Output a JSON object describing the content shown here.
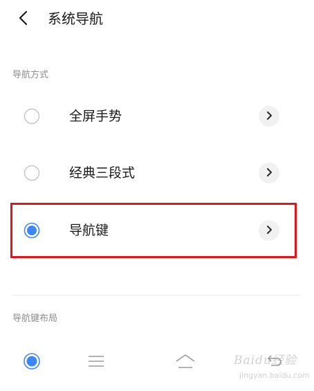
{
  "header": {
    "title": "系统导航",
    "back_icon": "chevron-left-icon"
  },
  "sections": {
    "nav_method_label": "导航方式",
    "nav_layout_label": "导航键布局"
  },
  "nav_options": [
    {
      "label": "全屏手势",
      "selected": false,
      "highlighted": false
    },
    {
      "label": "经典三段式",
      "selected": false,
      "highlighted": false
    },
    {
      "label": "导航键",
      "selected": true,
      "highlighted": true
    }
  ],
  "layout_options": [
    {
      "icon": "radio-selected-icon",
      "selected": true
    },
    {
      "icon": "menu-icon"
    },
    {
      "icon": "home-icon"
    },
    {
      "icon": "back-icon"
    }
  ],
  "watermark": {
    "title": "Baidu经验",
    "subtitle": "jingyan.baidu.com"
  },
  "colors": {
    "accent": "#3d86f6",
    "highlight_border": "#e4141b",
    "muted_text": "#8c8c8c",
    "chevron_bg": "#f1f1f1"
  }
}
